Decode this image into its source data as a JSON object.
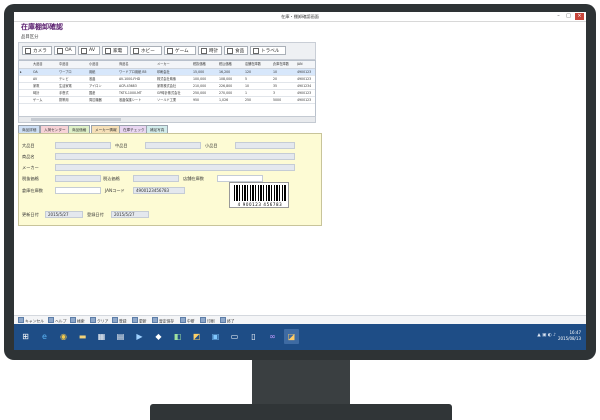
{
  "window": {
    "title": "在庫・棚卸確認画面"
  },
  "page_title": "在庫棚卸確認",
  "category_section": {
    "label": "品目区分",
    "items": [
      "カメラ",
      "OA",
      "AV",
      "家電",
      "ホビー",
      "ゲーム",
      "時計",
      "食品",
      "トラベル"
    ]
  },
  "grid": {
    "columns": [
      "大品目",
      "中品目",
      "小品目",
      "商品名",
      "メーカー",
      "税抜価格",
      "税込価格",
      "店舗在庫数",
      "倉庫在庫数",
      "JAN"
    ],
    "rows": [
      [
        "OA",
        "ワープロ",
        "用紙",
        "ワードプロ用紙 B5",
        "印刷会社",
        "15,000",
        "16,200",
        "120",
        "10",
        "4900123"
      ],
      [
        "AV",
        "テレビ",
        "液晶",
        "AV-1000-FHD",
        "株式会社映像",
        "100,000",
        "108,000",
        "5",
        "20",
        "4900123"
      ],
      [
        "家電",
        "生活家電",
        "アイロン",
        "ACR-43683",
        "家電株式会社",
        "210,000",
        "226,800",
        "10",
        "35",
        "4901234"
      ],
      [
        "時計",
        "手巻式",
        "国産",
        "TKTS-1000-MT",
        "GP時計株式会社",
        "250,000",
        "270,000",
        "1",
        "3",
        "4900123"
      ],
      [
        "ゲーム",
        "携帯用",
        "周辺機器",
        "液晶保護シート",
        "ソールド工業",
        "950",
        "1,026",
        "250",
        "5000",
        "4900123"
      ]
    ]
  },
  "tabs": [
    "商品詳細",
    "入荷センター",
    "商品価格",
    "メーカー情報",
    "在庫チェック",
    "補足写真"
  ],
  "detail": {
    "labels": {
      "large": "大品目",
      "middle": "中品目",
      "small": "小品目",
      "product_name": "商品名",
      "maker": "メーカー",
      "price_ex_tax": "税抜価格",
      "price_in_tax": "税込価格",
      "store_stock": "店舗在庫数",
      "warehouse_stock": "倉庫在庫数",
      "jan_code": "JANコード",
      "updated_on": "更新日付",
      "registered_on": "登録日付"
    },
    "values": {
      "jan_code": "4900123456783",
      "updated_on": "2015/5/27",
      "registered_on": "2015/5/27"
    },
    "barcode_number": "4 900123 456783"
  },
  "fkeys": [
    "キャンセル",
    "ヘルプ",
    "検索",
    "クリア",
    "登録",
    "更新",
    "暫定保存",
    "中断",
    "印刷",
    "終了"
  ],
  "taskbar": {
    "icons": [
      "start-icon",
      "ie-icon",
      "chrome-icon",
      "file-explorer-icon",
      "calendar-icon",
      "grid-app-icon",
      "media-player-icon",
      "app-icon-1",
      "app-icon-2",
      "app-icon-3",
      "app-icon-4",
      "app-icon-5",
      "app-icon-6",
      "visual-studio-icon",
      "current-app-icon"
    ],
    "clock_time": "16:47",
    "clock_date": "2015/08/13"
  },
  "colors": {
    "title_purple": "#5a1f6f",
    "detail_background": "#fdfbd4",
    "selected_row": "#d7e7fb",
    "taskbar": "#1e4d86",
    "tab_colors": [
      "#cfe0f5",
      "#f7d3d7",
      "#dff1c8",
      "#f6e0b8",
      "#e8d6f1",
      "#d2ecec"
    ]
  }
}
